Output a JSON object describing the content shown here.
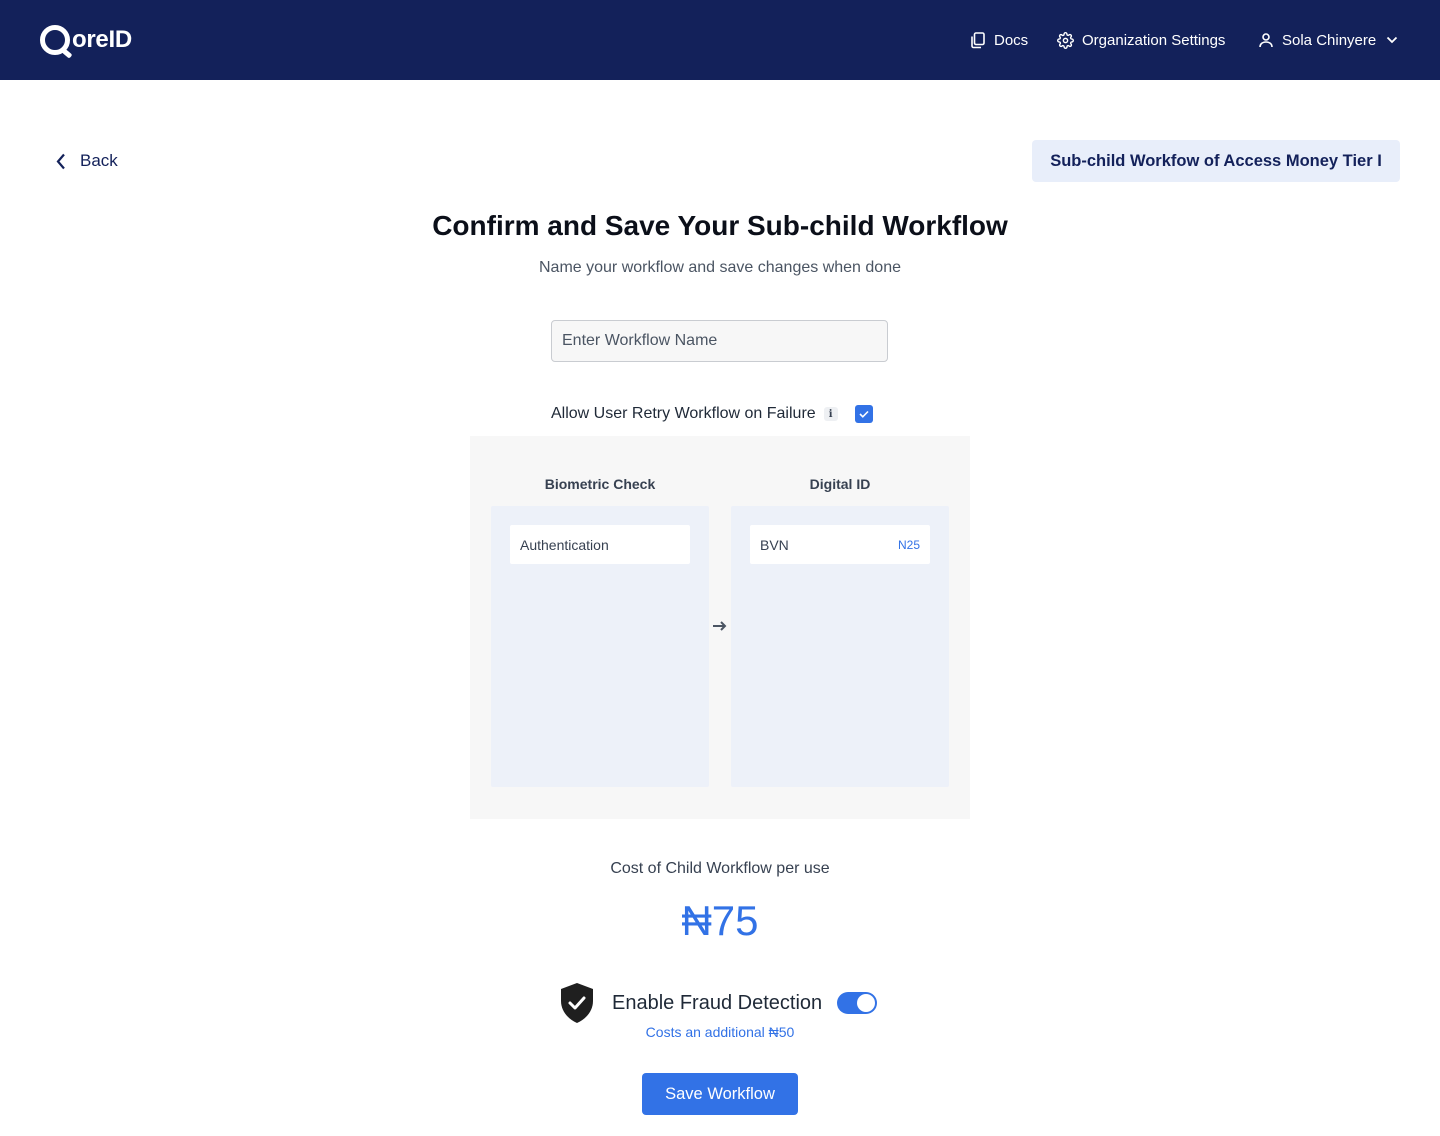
{
  "header": {
    "logo_text": "oreID",
    "nav": {
      "docs_label": "Docs",
      "org_settings_label": "Organization Settings",
      "user_name": "Sola Chinyere"
    }
  },
  "back_label": "Back",
  "parent_workflow_tag": "Sub-child Workfow of Access Money Tier I",
  "title": "Confirm and Save Your Sub-child Workflow",
  "subtitle": "Name your workflow and save changes when done",
  "workflow_name_input": {
    "value": "",
    "placeholder": "Enter Workflow Name"
  },
  "retry_option": {
    "label": "Allow User Retry Workflow on Failure",
    "checked": true
  },
  "workflow_steps": [
    {
      "category": "Biometric Check",
      "items": [
        {
          "name": "Authentication",
          "price": ""
        }
      ]
    },
    {
      "category": "Digital ID",
      "items": [
        {
          "name": "BVN",
          "price": "N25"
        }
      ]
    }
  ],
  "cost": {
    "label": "Cost of Child Workflow per use",
    "value": "₦75"
  },
  "fraud_detection": {
    "label": "Enable Fraud Detection",
    "enabled": true,
    "note": "Costs an additional ₦50"
  },
  "save_button_label": "Save Workflow",
  "colors": {
    "header_bg": "#13215a",
    "accent": "#3272e6",
    "tag_bg": "#e8eefa",
    "canvas_bg": "#f7f7f7",
    "column_bg": "#edf1f9"
  },
  "icons": {
    "docs": "copy-icon",
    "settings": "gear-icon",
    "user": "user-icon",
    "back": "chevron-left-icon",
    "info": "info-icon",
    "arrow": "arrow-right-icon",
    "fraud": "shield-check-icon"
  }
}
